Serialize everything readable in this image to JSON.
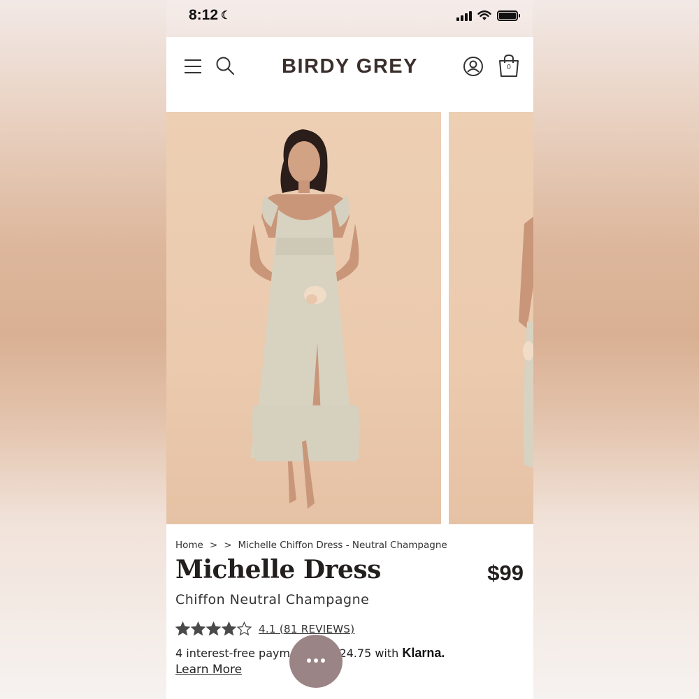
{
  "status_bar": {
    "time": "8:12",
    "moon_icon": "moon-icon",
    "signal_icon": "cellular-signal-icon",
    "wifi_icon": "wifi-icon",
    "battery_icon": "battery-icon"
  },
  "header": {
    "brand": "BIRDY GREY",
    "menu_icon": "hamburger-menu-icon",
    "search_icon": "search-icon",
    "account_icon": "account-icon",
    "cart_icon": "shopping-bag-icon",
    "cart_count": "0"
  },
  "gallery": {
    "images": [
      "product-photo-front",
      "product-photo-side"
    ]
  },
  "product": {
    "breadcrumb": {
      "home": "Home",
      "sep1": ">",
      "sep2": ">",
      "current": "Michelle Chiffon Dress - Neutral Champagne"
    },
    "title": "Michelle Dress",
    "price": "$99",
    "subtitle": "Chiffon Neutral Champagne",
    "rating": {
      "value": 4.1,
      "max": 5,
      "link_text": "4.1 (81 REVIEWS)"
    },
    "payment": {
      "text": "4 interest-free payments of $24.75 with",
      "provider": "Klarna.",
      "learn_more": "Learn More"
    }
  },
  "chat": {
    "icon": "chat-icon"
  },
  "colors": {
    "brand_text": "#3b2f2c",
    "photo_backdrop": "#ebcaae",
    "chat_button": "#9b8486",
    "star": "#4a4a4a"
  }
}
